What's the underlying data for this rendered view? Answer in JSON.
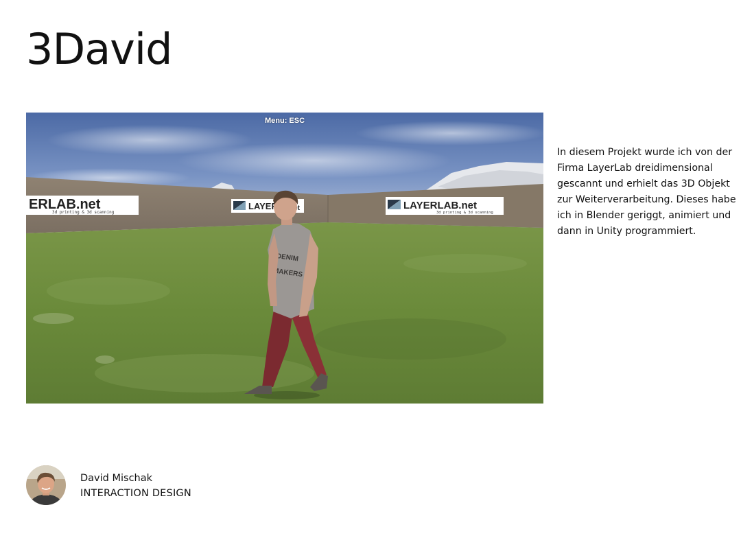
{
  "page": {
    "title": "3David",
    "description": "In diesem Projekt wurde ich von der Firma LayerLab dreidimensional gescannt und erhielt das 3D Objekt zur Weiterverarbeitung. Dieses habe ich in Blender geriggt, animiert und dann in Unity programmiert."
  },
  "game_view": {
    "menu_hint": "Menu: ESC",
    "banners": {
      "left_text": "ERLAB.net",
      "left_subtext": "3d printing & 3d scanning",
      "center_text": "LAYER",
      "center_suffix": "net",
      "right_text": "LAYERLAB.net",
      "right_subtext": "3d printing & 3d scanning"
    },
    "shirt_print": {
      "line1": "DENIM",
      "line2": "MAKERS"
    },
    "colors": {
      "sky": "#5a79b0",
      "grass": "#6d8c3c",
      "wall": "#8a7c6c",
      "trousers": "#7d2a30",
      "shirt": "#9a9693"
    }
  },
  "author": {
    "name": "David Mischak",
    "role": "INTERACTION DESIGN",
    "avatar_icon": "person-avatar"
  }
}
